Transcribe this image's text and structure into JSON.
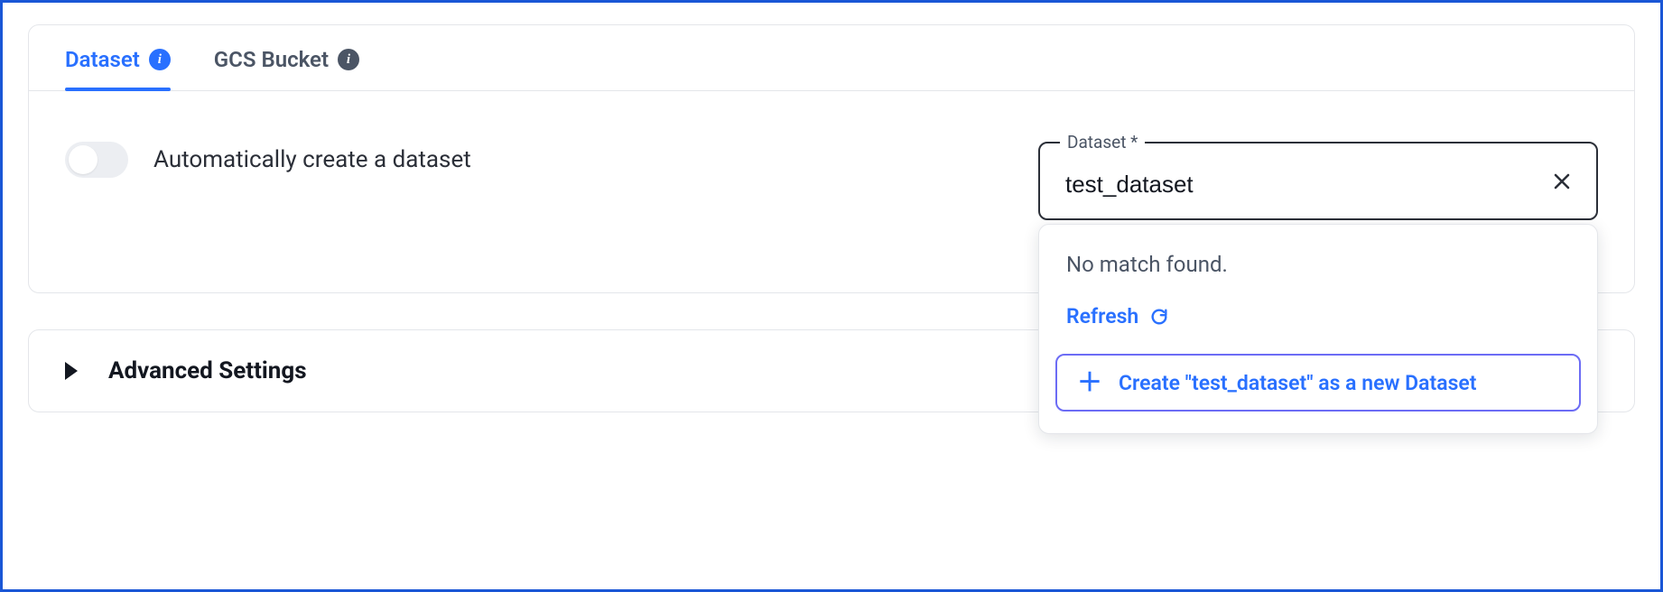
{
  "tabs": {
    "dataset": {
      "label": "Dataset"
    },
    "gcs_bucket": {
      "label": "GCS Bucket"
    }
  },
  "toggle": {
    "label": "Automatically create a dataset",
    "on": false
  },
  "dataset_field": {
    "legend": "Dataset *",
    "value": "test_dataset"
  },
  "dropdown": {
    "no_match": "No match found.",
    "refresh": "Refresh",
    "create_label": "Create \"test_dataset\" as a new Dataset"
  },
  "advanced": {
    "label": "Advanced Settings"
  }
}
